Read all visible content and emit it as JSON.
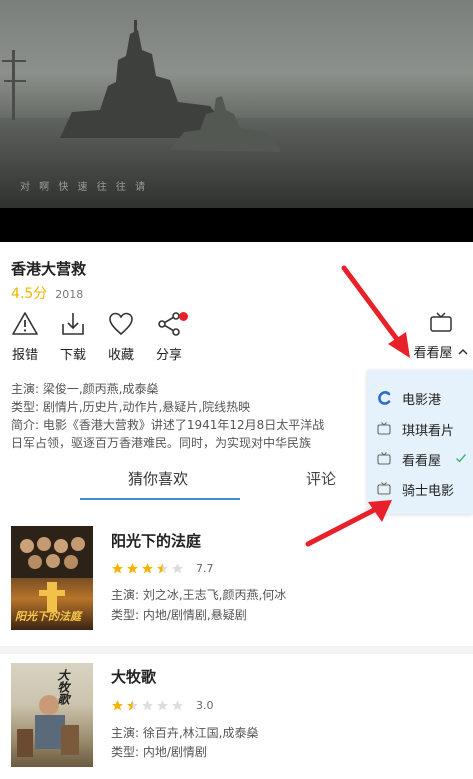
{
  "video": {
    "subtitle": "对  啊    快  速  往   往  请"
  },
  "movie": {
    "title": "香港大营救",
    "score": "4.5分",
    "year": "2018",
    "actions": [
      {
        "label": "报错",
        "icon": "warning-icon"
      },
      {
        "label": "下载",
        "icon": "download-icon"
      },
      {
        "label": "收藏",
        "icon": "heart-icon"
      },
      {
        "label": "分享",
        "icon": "share-icon"
      }
    ],
    "source_selected": "看看屋",
    "cast_line": "主演: 梁俊一,颜丙燕,成泰燊",
    "genre_line": "类型: 剧情片,历史片,动作片,悬疑片,院线热映",
    "intro_line1": "简介: 电影《香港大营救》讲述了1941年12月8日太平洋战",
    "intro_line2": "日军占领，驱逐百万香港难民。同时，为实现对中华民族"
  },
  "tabs": [
    {
      "label": "猜你喜欢"
    },
    {
      "label": "评论"
    }
  ],
  "sources": [
    {
      "label": "电影港",
      "icon": "c-logo-icon"
    },
    {
      "label": "琪琪看片",
      "icon": "tv-icon"
    },
    {
      "label": "看看屋",
      "icon": "tv-icon",
      "selected": true
    },
    {
      "label": "骑士电影",
      "icon": "tv-icon"
    }
  ],
  "recommendations": [
    {
      "title": "阳光下的法庭",
      "stars": 3.5,
      "rating": "7.7",
      "cast": "主演: 刘之冰,王志飞,颜丙燕,何冰",
      "genre": "类型: 内地/剧情剧,悬疑剧",
      "poster_text": "阳光下的法庭"
    },
    {
      "title": "大牧歌",
      "stars": 1.5,
      "rating": "3.0",
      "cast": "主演: 徐百卉,林江国,成泰燊",
      "genre": "类型: 内地/剧情剧",
      "poster_text": "大牧歌"
    }
  ],
  "colors": {
    "accent_blue": "#3d8ee0",
    "score_yellow": "#f0b400",
    "star": "#f5b400",
    "red_dot": "#e8202a",
    "arrow_red": "#e8202a",
    "dropdown_bg": "#e6f2fb"
  }
}
